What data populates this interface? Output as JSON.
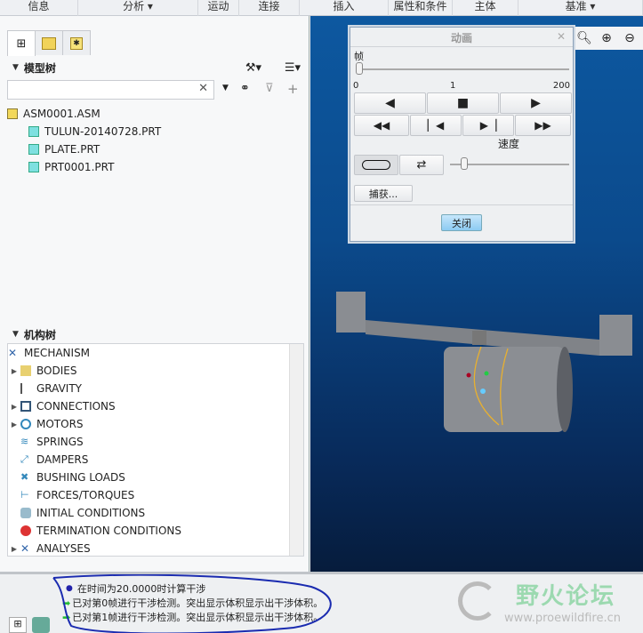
{
  "menu": [
    "信息",
    "分析 ▾",
    "运动",
    "连接",
    "插入",
    "属性和条件",
    "主体",
    "基准 ▾"
  ],
  "model_tree": {
    "title": "模型树",
    "items": [
      "ASM0001.ASM",
      "TULUN-20140728.PRT",
      "PLATE.PRT",
      "PRT0001.PRT"
    ]
  },
  "mechanism_tree": {
    "title": "机构树",
    "items": [
      "MECHANISM",
      "BODIES",
      "GRAVITY",
      "CONNECTIONS",
      "MOTORS",
      "SPRINGS",
      "DAMPERS",
      "BUSHING LOADS",
      "FORCES/TORQUES",
      "INITIAL CONDITIONS",
      "TERMINATION CONDITIONS",
      "ANALYSES"
    ]
  },
  "dialog": {
    "title": "动画",
    "frame_label": "帧",
    "frame_min": "0",
    "frame_current": "1",
    "frame_max": "200",
    "frame_value_fraction": 0.005,
    "speed_label": "速度",
    "capture": "捕获...",
    "close": "关闭"
  },
  "status": {
    "messages": [
      "在时间为20.0000时计算干涉",
      "已对第0帧进行干涉检测。突出显示体积显示出干涉体积。",
      "已对第1帧进行干涉检测。突出显示体积显示出干涉体积。"
    ]
  },
  "watermark": {
    "title": "野火论坛",
    "url": "www.proewildfire.cn"
  }
}
